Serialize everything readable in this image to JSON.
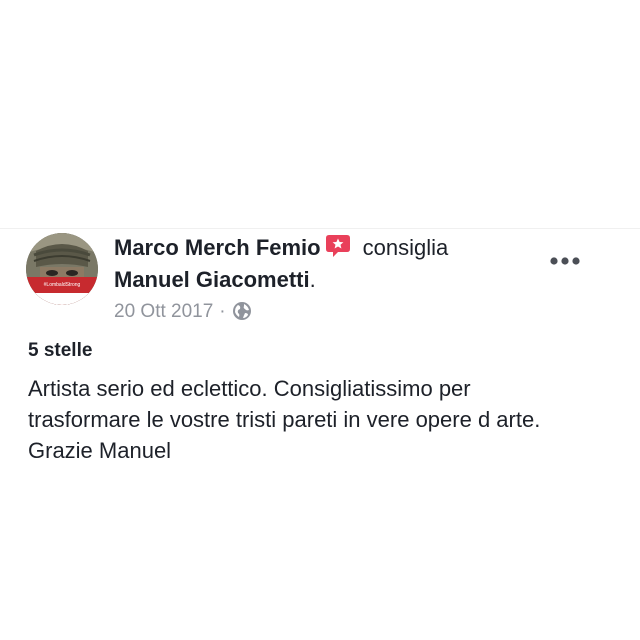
{
  "post": {
    "author": "Marco Merch Femio",
    "action": "consiglia",
    "target": "Manuel Giacometti",
    "date": "20 Ott 2017",
    "separator": "·",
    "privacy_icon": "globe-icon",
    "rating": "5 stelle",
    "body_lines": [
      "Artista serio ed eclettico. Consigliatissimo per",
      "trasformare le vostre tristi pareti in vere opere d arte.",
      "Grazie Manuel"
    ],
    "avatar_badge_text": "#LombaldStrong",
    "more_icon": "more-options-icon",
    "recommend_icon": "recommend-icon"
  },
  "colors": {
    "recommend": "#e9405a",
    "meta_text": "#90949c",
    "primary_text": "#1d2129"
  }
}
